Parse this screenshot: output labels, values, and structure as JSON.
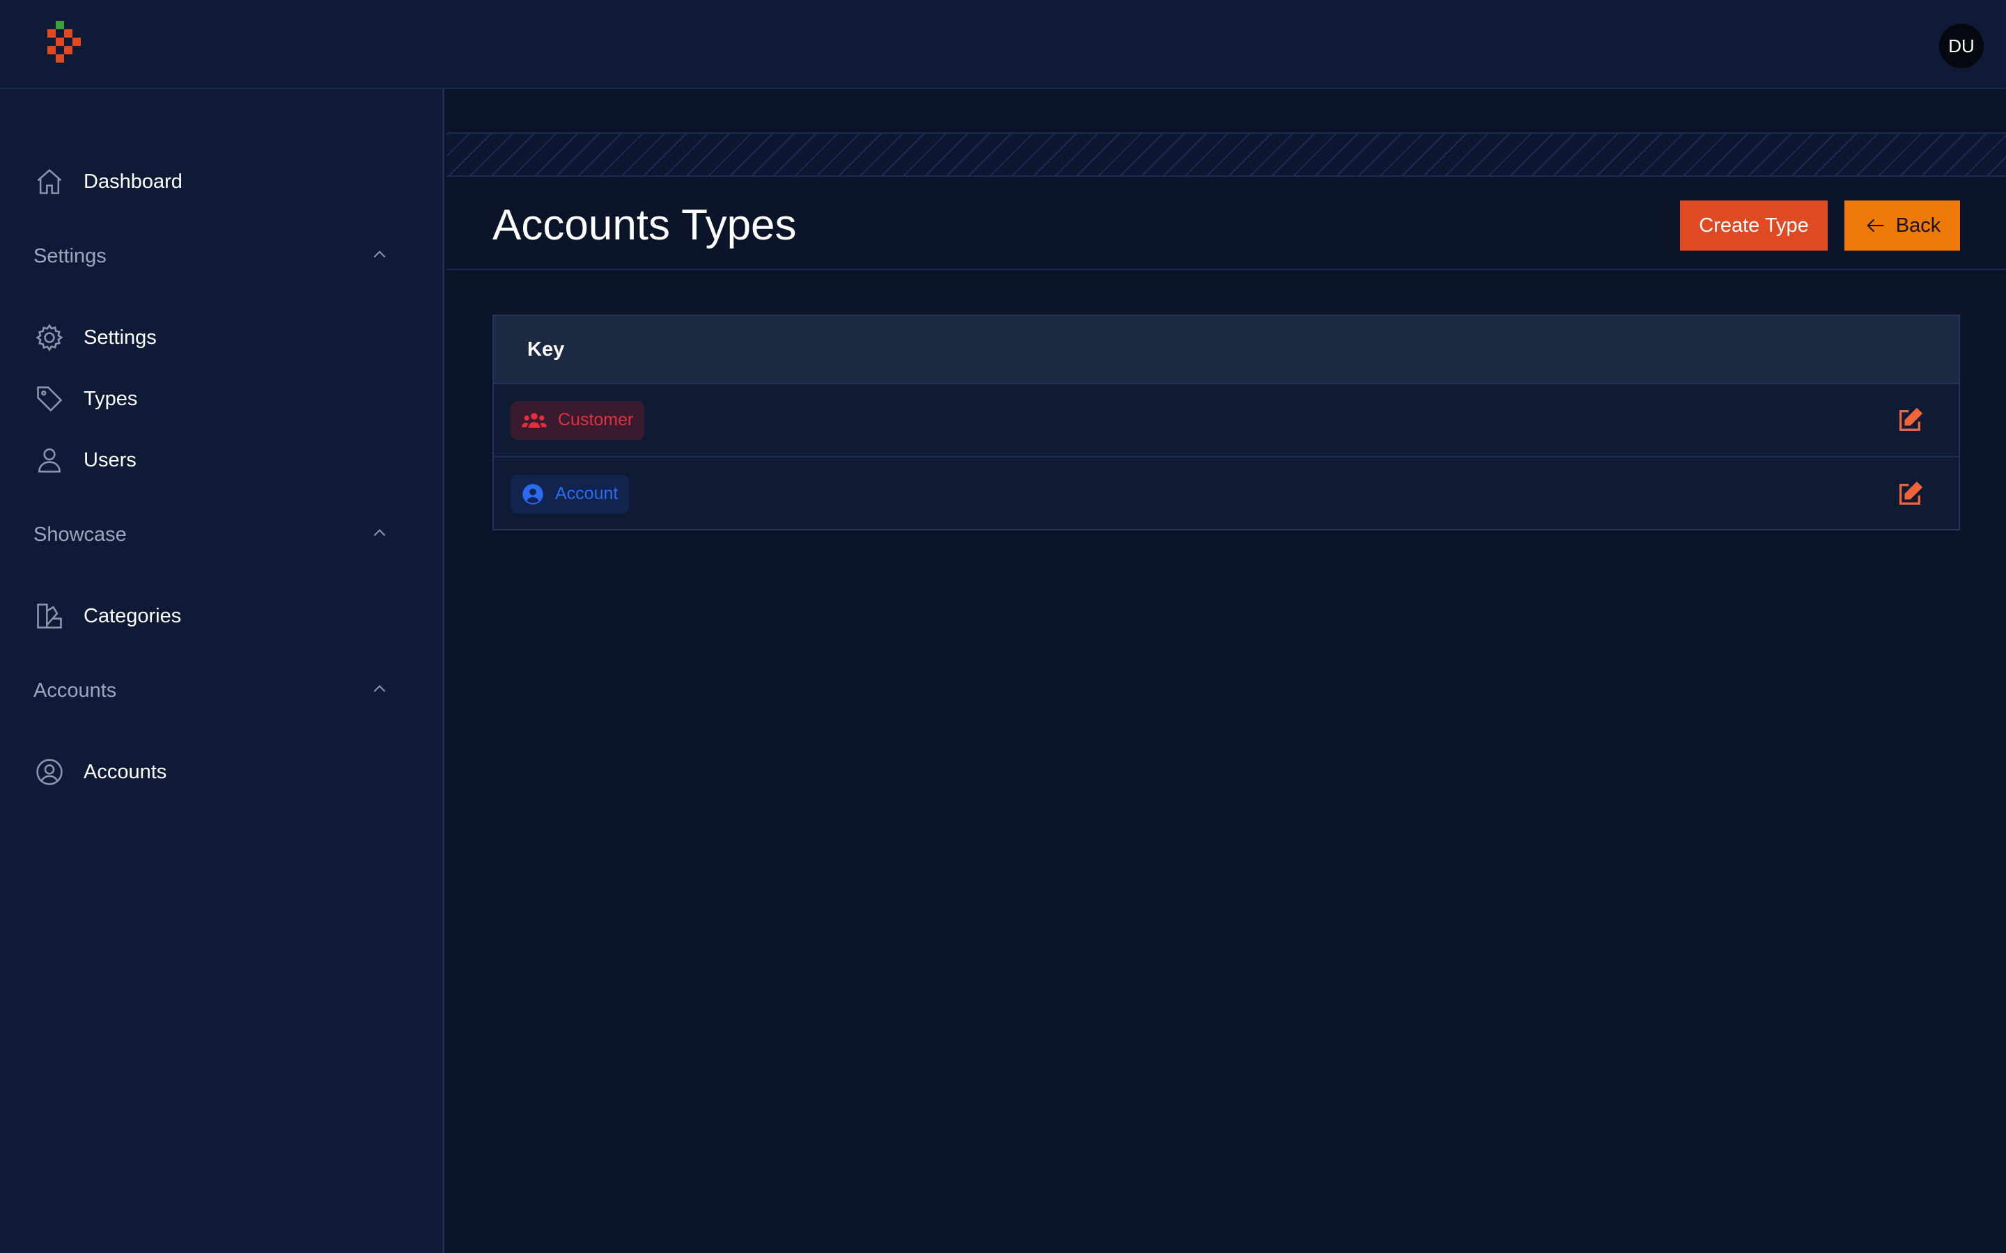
{
  "header": {
    "avatar_initials": "DU"
  },
  "sidebar": {
    "top_items": [
      {
        "label": "Dashboard",
        "icon": "home-icon"
      }
    ],
    "sections": [
      {
        "title": "Settings",
        "items": [
          {
            "label": "Settings",
            "icon": "gear-icon"
          },
          {
            "label": "Types",
            "icon": "tag-icon"
          },
          {
            "label": "Users",
            "icon": "user-icon"
          }
        ]
      },
      {
        "title": "Showcase",
        "items": [
          {
            "label": "Categories",
            "icon": "swatch-icon"
          }
        ]
      },
      {
        "title": "Accounts",
        "items": [
          {
            "label": "Accounts",
            "icon": "user-circle-icon"
          }
        ]
      }
    ]
  },
  "main": {
    "title": "Accounts Types",
    "create_label": "Create Type",
    "back_label": "Back",
    "table": {
      "columns": [
        "Key"
      ],
      "rows": [
        {
          "label": "Customer",
          "icon": "users-icon",
          "color": "#e42f3b"
        },
        {
          "label": "Account",
          "icon": "user-circle-icon",
          "color": "#2a6bf2"
        }
      ]
    }
  },
  "colors": {
    "accent": "#e04a22",
    "back_button": "#ee7a0c",
    "background": "#0b1428",
    "sidebar": "#0f1b36"
  }
}
